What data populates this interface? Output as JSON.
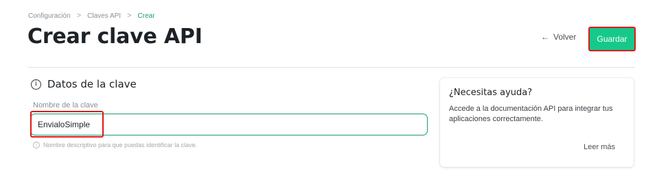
{
  "breadcrumb": {
    "items": [
      "Configuración",
      "Claves API",
      "Crear"
    ],
    "separator": ">"
  },
  "header": {
    "title": "Crear clave API",
    "back_label": "Volver",
    "save_label": "Guardar"
  },
  "form": {
    "section_title": "Datos de la clave",
    "name_label": "Nombre de la clave",
    "name_value": "EnvialoSimple",
    "name_hint": "Nombre descriptivo para que puedas identificar la clave."
  },
  "help": {
    "title": "¿Necesitas ayuda?",
    "text": "Accede a la documentación API para integrar tus aplicaciones correctamente.",
    "link_label": "Leer más"
  },
  "colors": {
    "accent": "#16c98a",
    "highlight": "#e01818"
  },
  "icons": {
    "back": "arrow-left-icon",
    "section": "info-icon",
    "hint": "info-icon"
  }
}
